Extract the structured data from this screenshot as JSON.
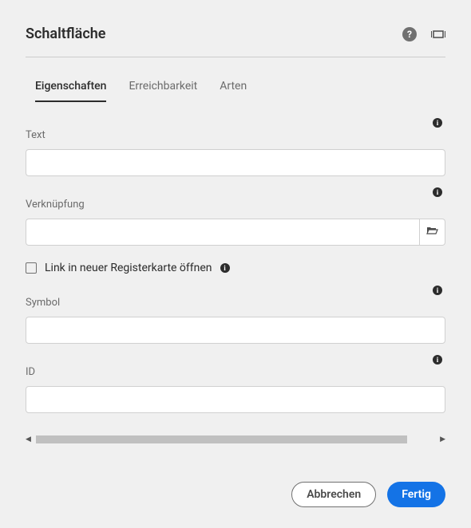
{
  "header": {
    "title": "Schaltfläche"
  },
  "tabs": {
    "properties": "Eigenschaften",
    "accessibility": "Erreichbarkeit",
    "styles": "Arten"
  },
  "fields": {
    "text": {
      "label": "Text",
      "value": ""
    },
    "link": {
      "label": "Verknüpfung",
      "value": ""
    },
    "newtab": {
      "label": "Link in neuer Registerkarte öffnen"
    },
    "symbol": {
      "label": "Symbol",
      "value": ""
    },
    "id": {
      "label": "ID",
      "value": ""
    }
  },
  "footer": {
    "cancel": "Abbrechen",
    "done": "Fertig"
  }
}
